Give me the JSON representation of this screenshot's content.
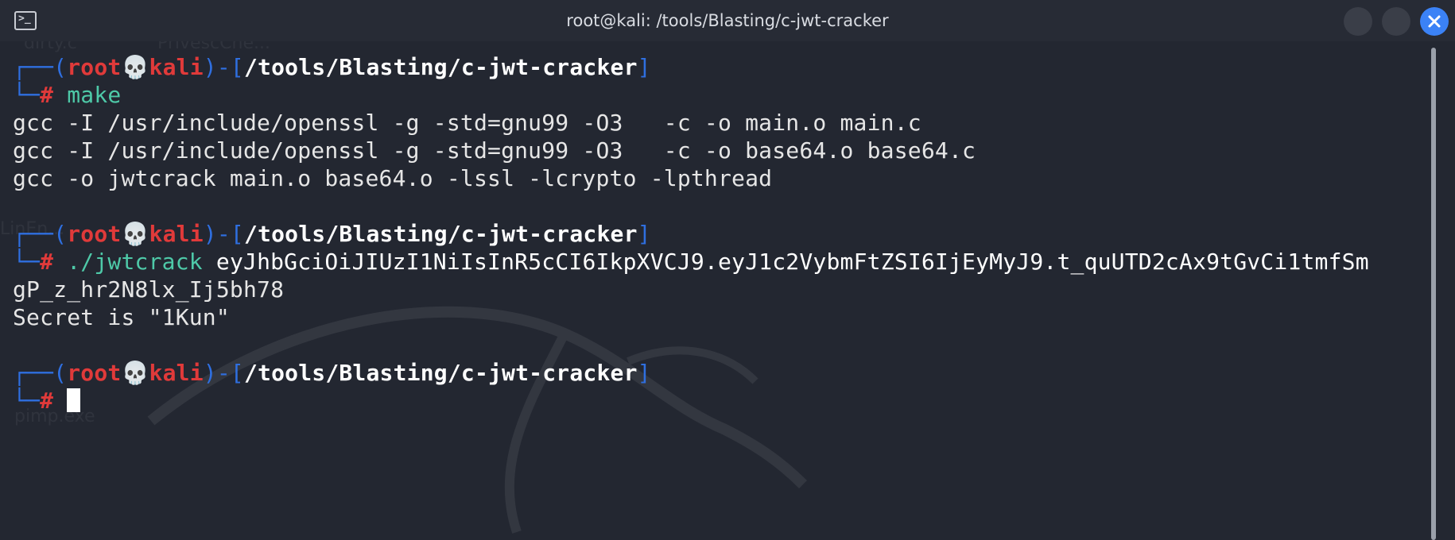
{
  "window": {
    "title": "root@kali: /tools/Blasting/c-jwt-cracker",
    "terminal_icon_glyph": ">_",
    "accent_color": "#3b82f6"
  },
  "desktop": {
    "ghost_icons": [
      "dirty.c",
      "PrivescChe...",
      "LinEn...",
      "pimp.exe"
    ]
  },
  "prompt": {
    "box_top": "┌──(",
    "user": "root",
    "skull": "💀",
    "host": "kali",
    "close_paren": ")-[",
    "path": "/tools/Blasting/c-jwt-cracker",
    "close_bracket": "]",
    "box_bottom": "└─",
    "hash": "#"
  },
  "session": {
    "cmd1": "make",
    "out1": [
      "gcc -I /usr/include/openssl -g -std=gnu99 -O3   -c -o main.o main.c",
      "gcc -I /usr/include/openssl -g -std=gnu99 -O3   -c -o base64.o base64.c",
      "gcc -o jwtcrack main.o base64.o -lssl -lcrypto -lpthread"
    ],
    "cmd2_name": "./jwtcrack",
    "cmd2_arg": "eyJhbGciOiJIUzI1NiIsInR5cCI6IkpXVCJ9.eyJ1c2VybmFtZSI6IjEyMyJ9.t_quUTD2cAx9tGvCi1tmfSm",
    "cmd2_arg_wrap": "gP_z_hr2N8lx_Ij5bh78",
    "out2": "Secret is \"1Kun\""
  }
}
